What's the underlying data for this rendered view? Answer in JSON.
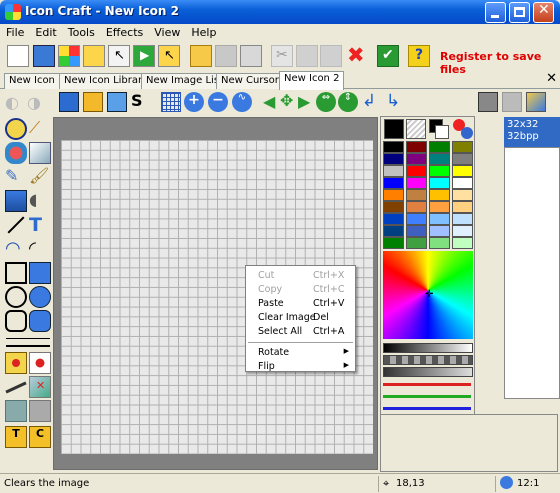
{
  "window": {
    "title": "Icon Craft - New Icon 2"
  },
  "menu": [
    "File",
    "Edit",
    "Tools",
    "Effects",
    "View",
    "Help"
  ],
  "toolbar": {
    "register_text": "Register to save files"
  },
  "tabs": [
    "New Icon 1",
    "New Icon Library 1",
    "New Image List 1",
    "New Cursor 1",
    "New Icon 2"
  ],
  "active_tab": "New Icon 2",
  "context_menu": {
    "items": [
      {
        "label": "Cut",
        "shortcut": "Ctrl+X",
        "enabled": false
      },
      {
        "label": "Copy",
        "shortcut": "Ctrl+C",
        "enabled": false
      },
      {
        "label": "Paste",
        "shortcut": "Ctrl+V",
        "enabled": true
      },
      {
        "label": "Clear Image",
        "shortcut": "Del",
        "enabled": true
      },
      {
        "label": "Select All",
        "shortcut": "Ctrl+A",
        "enabled": true
      },
      {
        "label": "Rotate",
        "shortcut": "",
        "enabled": true
      },
      {
        "label": "Flip",
        "shortcut": "",
        "enabled": true
      }
    ]
  },
  "format": {
    "size": "32x32",
    "depth": "32bpp"
  },
  "status": {
    "text": "Clears the image",
    "coords": "18,13",
    "zoom": "12:1"
  },
  "colors": {
    "titlebar": "#0a5fd8",
    "accent": "#316ac5",
    "register": "#e00000"
  },
  "palette_swatches": [
    "#000000",
    "#7f0000",
    "#007f00",
    "#7f7f00",
    "#00007f",
    "#7f007f",
    "#007f7f",
    "#7f7f7f",
    "#c0c0c0",
    "#ff0000",
    "#00ff00",
    "#ffff00",
    "#0000ff",
    "#ff00ff",
    "#00ffff",
    "#ffffff",
    "#ff8000",
    "#c08040",
    "#ffc000",
    "#ffe0a0",
    "#804000",
    "#e08040",
    "#ffa040",
    "#ffd080",
    "#0040c0",
    "#4080ff",
    "#80c0ff",
    "#c0e0ff",
    "#004080",
    "#4060c0",
    "#a0c0ff",
    "#e0f0ff",
    "#008000",
    "#40a040",
    "#80e080",
    "#c0ffc0"
  ]
}
